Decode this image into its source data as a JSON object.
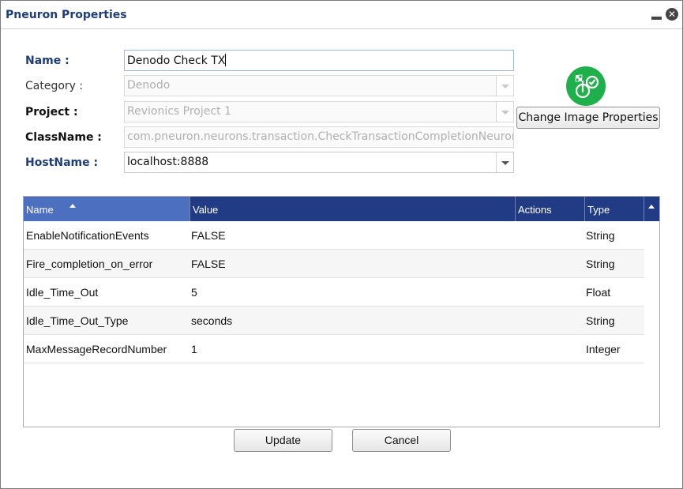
{
  "window": {
    "title": "Pneuron Properties",
    "minimize_icon": "minimize-icon",
    "close_icon": "close-circle-icon",
    "close_glyph": "✕"
  },
  "form": {
    "name": {
      "label": "Name :",
      "value": "Denodo Check TX"
    },
    "category": {
      "label": "Category :",
      "value": "Denodo"
    },
    "project": {
      "label": "Project :",
      "value": "Revionics Project 1"
    },
    "classname": {
      "label": "ClassName :",
      "value": "com.pneuron.neurons.transaction.CheckTransactionCompletionNeuron"
    },
    "hostname": {
      "label": "HostName :",
      "value": "localhost:8888"
    }
  },
  "image": {
    "icon": "pneuron-checklist-icon",
    "button_label": "Change Image Properties",
    "color": "#20b04b"
  },
  "grid": {
    "columns": {
      "name": "Name",
      "value": "Value",
      "actions": "Actions",
      "type": "Type"
    },
    "sort": "Name ascending",
    "rows": [
      {
        "name": "EnableNotificationEvents",
        "value": "FALSE",
        "actions": "",
        "type": "String"
      },
      {
        "name": "Fire_completion_on_error",
        "value": "FALSE",
        "actions": "",
        "type": "String"
      },
      {
        "name": "Idle_Time_Out",
        "value": "5",
        "actions": "",
        "type": "Float"
      },
      {
        "name": "Idle_Time_Out_Type",
        "value": "seconds",
        "actions": "",
        "type": "String"
      },
      {
        "name": "MaxMessageRecordNumber",
        "value": "1",
        "actions": "",
        "type": "Integer"
      }
    ]
  },
  "buttons": {
    "update": "Update",
    "cancel": "Cancel"
  },
  "colors": {
    "title": "#1f3d7a",
    "header": "#213c84",
    "header_sorted": "#4d6fc0"
  }
}
